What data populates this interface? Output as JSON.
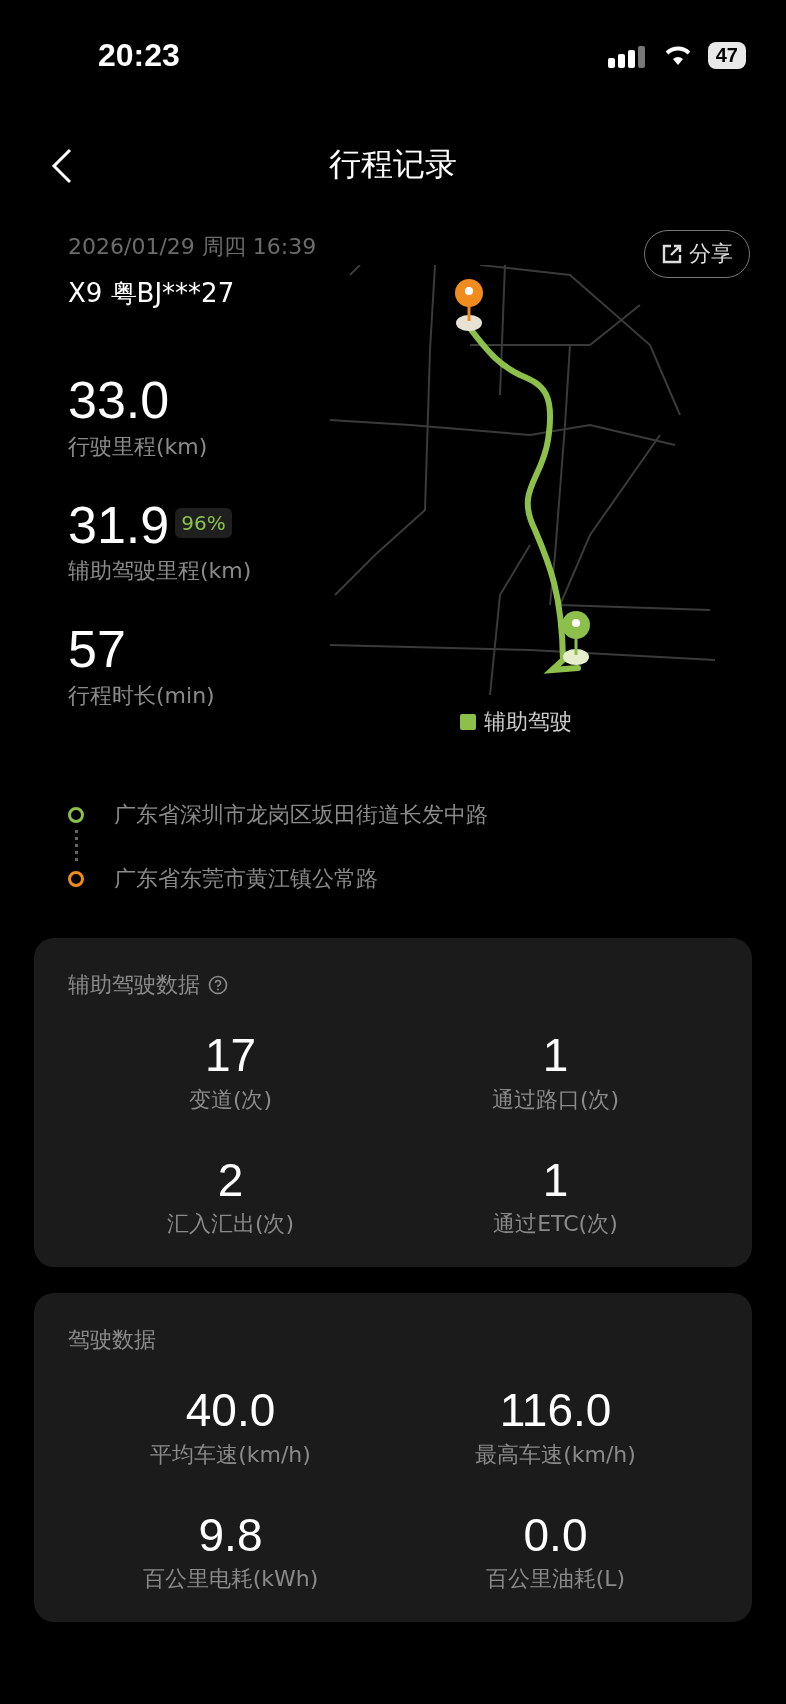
{
  "status_bar": {
    "time": "20:23",
    "battery": "47"
  },
  "header": {
    "title": "行程记录"
  },
  "trip": {
    "datetime": "2026/01/29 周四 16:39",
    "vehicle": "X9 粤BJ***27",
    "share": "分享",
    "stats": [
      {
        "value": "33.0",
        "label": "行驶里程(km)"
      },
      {
        "value": "31.9",
        "badge": "96%",
        "label": "辅助驾驶里程(km)"
      },
      {
        "value": "57",
        "label": "行程时长(min)"
      }
    ],
    "legend": "辅助驾驶",
    "route": [
      {
        "kind": "start",
        "address": "广东省深圳市龙岗区坂田街道长发中路"
      },
      {
        "kind": "end",
        "address": "广东省东莞市黄江镇公常路"
      }
    ]
  },
  "cards": [
    {
      "title": "辅助驾驶数据",
      "help_icon": true,
      "items": [
        {
          "value": "17",
          "label": "变道(次)"
        },
        {
          "value": "1",
          "label": "通过路口(次)"
        },
        {
          "value": "2",
          "label": "汇入汇出(次)"
        },
        {
          "value": "1",
          "label": "通过ETC(次)"
        }
      ]
    },
    {
      "title": "驾驶数据",
      "help_icon": false,
      "items": [
        {
          "value": "40.0",
          "label": "平均车速(km/h)"
        },
        {
          "value": "116.0",
          "label": "最高车速(km/h)"
        },
        {
          "value": "9.8",
          "label": "百公里电耗(kWh)"
        },
        {
          "value": "0.0",
          "label": "百公里油耗(L)"
        }
      ]
    }
  ]
}
